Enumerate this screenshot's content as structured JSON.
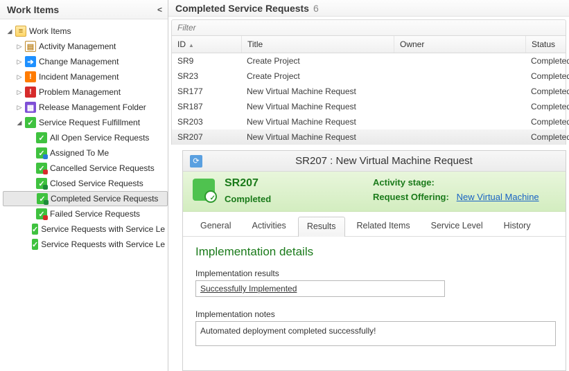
{
  "sidebar": {
    "title": "Work Items",
    "root": {
      "label": "Work Items"
    },
    "nodes": [
      {
        "label": "Activity Management"
      },
      {
        "label": "Change Management"
      },
      {
        "label": "Incident Management"
      },
      {
        "label": "Problem Management"
      },
      {
        "label": "Release Management Folder"
      },
      {
        "label": "Service Request Fulfillment"
      }
    ],
    "srff": [
      {
        "label": "All Open Service Requests"
      },
      {
        "label": "Assigned To Me"
      },
      {
        "label": "Cancelled Service Requests"
      },
      {
        "label": "Closed Service Requests"
      },
      {
        "label": "Completed Service Requests"
      },
      {
        "label": "Failed Service Requests"
      },
      {
        "label": "Service Requests with Service Le"
      },
      {
        "label": "Service Requests with Service Le"
      }
    ]
  },
  "grid": {
    "title": "Completed Service Requests",
    "count": "6",
    "filter_placeholder": "Filter",
    "columns": {
      "id": "ID",
      "title": "Title",
      "owner": "Owner",
      "status": "Status"
    },
    "rows": [
      {
        "id": "SR9",
        "title": "Create Project",
        "owner": "",
        "status": "Completed"
      },
      {
        "id": "SR23",
        "title": "Create Project",
        "owner": "",
        "status": "Completed"
      },
      {
        "id": "SR177",
        "title": "New Virtual Machine Request",
        "owner": "",
        "status": "Completed"
      },
      {
        "id": "SR187",
        "title": "New Virtual Machine Request",
        "owner": "",
        "status": "Completed"
      },
      {
        "id": "SR203",
        "title": "New Virtual Machine Request",
        "owner": "",
        "status": "Completed"
      },
      {
        "id": "SR207",
        "title": "New Virtual Machine Request",
        "owner": "",
        "status": "Completed"
      }
    ],
    "selected_index": 5
  },
  "detail": {
    "title": "SR207 : New Virtual Machine Request",
    "sr_id": "SR207",
    "status": "Completed",
    "activity_stage_label": "Activity stage:",
    "request_offering_label": "Request Offering:",
    "request_offering_value": "New Virtual Machine",
    "tabs": [
      "General",
      "Activities",
      "Results",
      "Related Items",
      "Service Level",
      "History"
    ],
    "active_tab": 2,
    "section_title": "Implementation details",
    "impl_results_label": "Implementation results",
    "impl_results_value": "Successfully Implemented",
    "impl_notes_label": "Implementation notes",
    "impl_notes_value": "Automated deployment completed successfully!"
  }
}
